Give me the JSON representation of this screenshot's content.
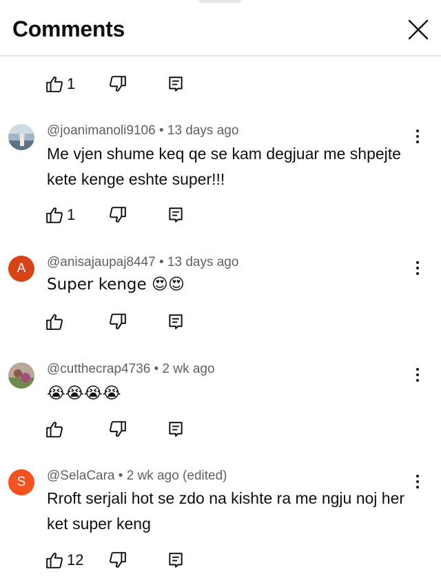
{
  "header": {
    "title": "Comments"
  },
  "top_actions": {
    "likes": "1"
  },
  "comments": [
    {
      "author": "@joanimanoli9106",
      "time": "13 days ago",
      "text": "Me vjen shume keq qe se kam degjuar me shpejte kete kenge eshte super!!!",
      "likes": "1"
    },
    {
      "author": "@anisajaupaj8447",
      "time": "13 days ago",
      "text": "Super kenge 😍😍",
      "likes": "",
      "avatar_letter": "A",
      "avatar_color": "#d84315"
    },
    {
      "author": "@cutthecrap4736",
      "time": "2 wk ago",
      "text": "😭😭😭😭",
      "likes": ""
    },
    {
      "author": "@SelaCara",
      "time": "2 wk ago (edited)",
      "text": "Rroft serjali hot se zdo na kishte ra me ngju noj her ket super keng",
      "likes": "12",
      "avatar_letter": "S",
      "avatar_color": "#f4511e"
    }
  ],
  "separator": " • "
}
